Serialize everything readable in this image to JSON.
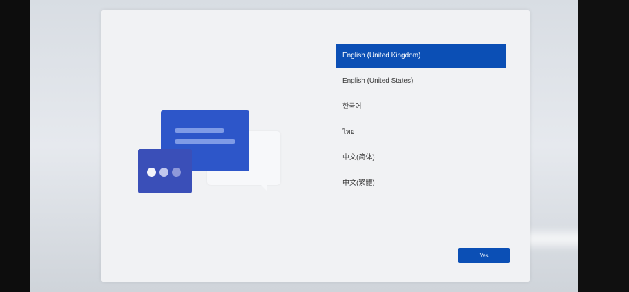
{
  "languages": [
    {
      "label": "English (United Kingdom)",
      "selected": true
    },
    {
      "label": "English (United States)",
      "selected": false
    },
    {
      "label": "한국어",
      "selected": false
    },
    {
      "label": "ไทย",
      "selected": false
    },
    {
      "label": "中文(简体)",
      "selected": false
    },
    {
      "label": "中文(繁體)",
      "selected": false
    }
  ],
  "actions": {
    "yes_label": "Yes"
  },
  "illustration": {
    "icon": "chat-bubbles-icon"
  },
  "colors": {
    "accent": "#0b4fb5",
    "card": "#f1f2f4",
    "illustration_back": "#2d56c9",
    "illustration_front": "#3a4fb8"
  }
}
